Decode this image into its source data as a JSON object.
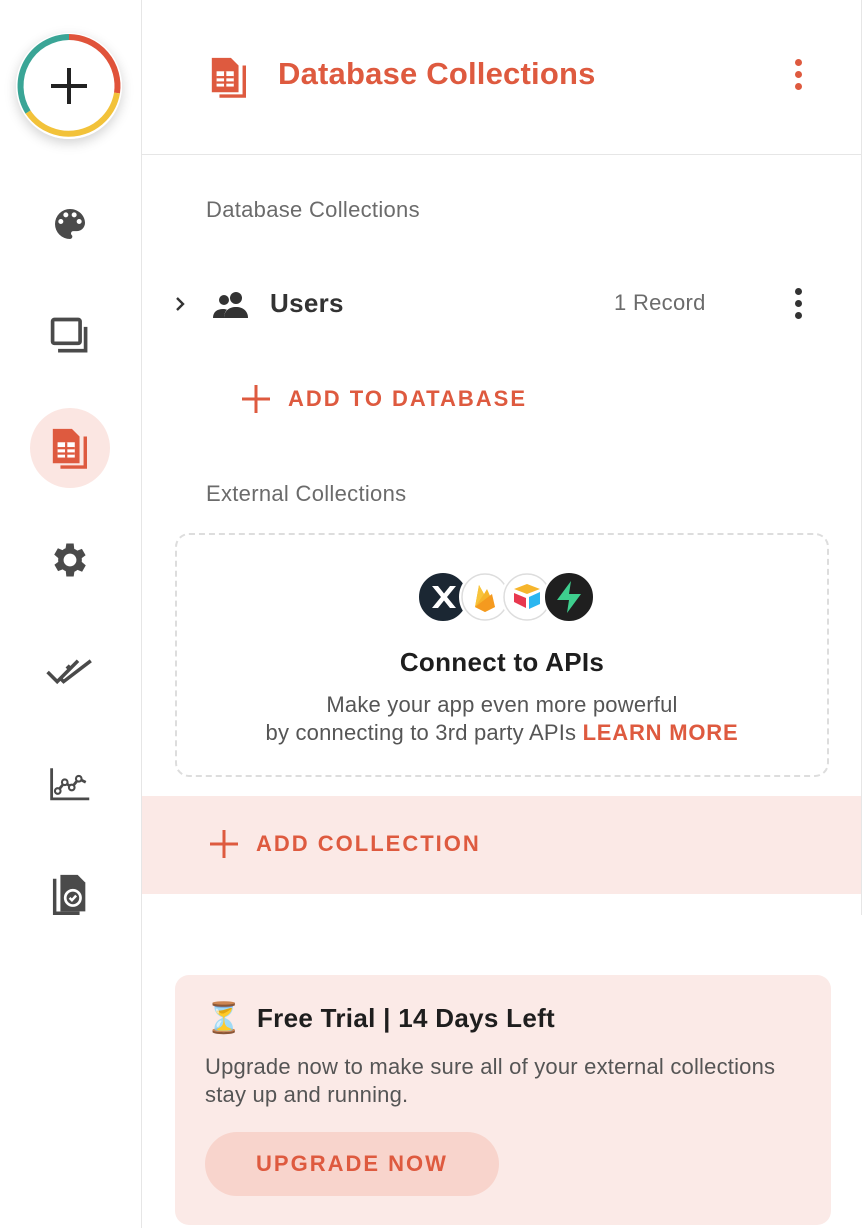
{
  "header": {
    "title": "Database Collections"
  },
  "sections": {
    "database_label": "Database Collections",
    "external_label": "External Collections"
  },
  "collections": [
    {
      "name": "Users",
      "count": "1 Record"
    }
  ],
  "buttons": {
    "add_to_database": "ADD TO DATABASE",
    "add_collection": "ADD COLLECTION",
    "upgrade_now": "UPGRADE NOW"
  },
  "external": {
    "title": "Connect to APIs",
    "desc_line1": "Make your app even more powerful",
    "desc_line2": "by connecting to 3rd party APIs",
    "learn_more": "LEARN MORE",
    "logos": [
      "xano-logo",
      "firebase-logo",
      "airtable-logo",
      "supabase-logo"
    ]
  },
  "trial": {
    "title": "Free Trial | 14 Days Left",
    "description": "Upgrade now to make sure all of your external collections stay up and running.",
    "emoji": "⏳"
  },
  "rail": {
    "items": [
      "palette-icon",
      "screens-icon",
      "database-icon",
      "settings-icon",
      "checks-icon",
      "analytics-icon",
      "publish-icon"
    ],
    "active": "database-icon"
  },
  "colors": {
    "accent": "#de5a3f",
    "accent_soft": "#fbe9e6",
    "text": "#2b2b2b",
    "muted": "#6b6b6b",
    "border": "#e6e6e6"
  }
}
